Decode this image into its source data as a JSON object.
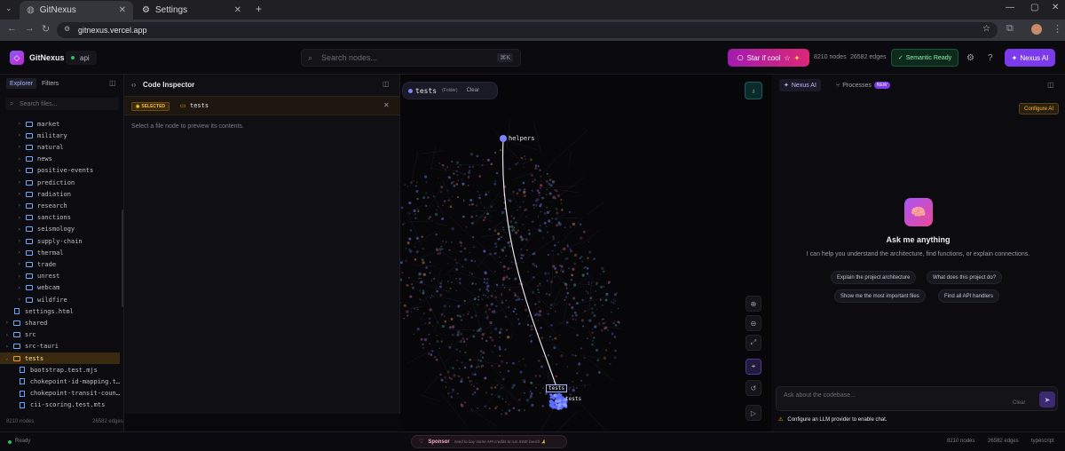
{
  "browser": {
    "tabs": [
      {
        "label": "GitNexus"
      },
      {
        "label": "Settings"
      }
    ],
    "url": "gitnexus.vercel.app"
  },
  "header": {
    "brand": "GitNexus",
    "repo": "api",
    "search_placeholder": "Search nodes...",
    "search_shortcut": "⌘K",
    "star_label": "Star if cool",
    "nodes_label": "8210 nodes",
    "edges_label": "26582 edges",
    "semantic_label": "Semantic Ready",
    "nexus_ai_label": "Nexus AI"
  },
  "sidebar": {
    "tabs": [
      "Explorer",
      "Filters"
    ],
    "search_placeholder": "Search files...",
    "tree": [
      {
        "label": "market",
        "type": "folder",
        "depth": 1
      },
      {
        "label": "military",
        "type": "folder",
        "depth": 1
      },
      {
        "label": "natural",
        "type": "folder",
        "depth": 1
      },
      {
        "label": "news",
        "type": "folder",
        "depth": 1
      },
      {
        "label": "positive-events",
        "type": "folder",
        "depth": 1
      },
      {
        "label": "prediction",
        "type": "folder",
        "depth": 1
      },
      {
        "label": "radiation",
        "type": "folder",
        "depth": 1
      },
      {
        "label": "research",
        "type": "folder",
        "depth": 1
      },
      {
        "label": "sanctions",
        "type": "folder",
        "depth": 1
      },
      {
        "label": "seismology",
        "type": "folder",
        "depth": 1
      },
      {
        "label": "supply-chain",
        "type": "folder",
        "depth": 1
      },
      {
        "label": "thermal",
        "type": "folder",
        "depth": 1
      },
      {
        "label": "trade",
        "type": "folder",
        "depth": 1
      },
      {
        "label": "unrest",
        "type": "folder",
        "depth": 1
      },
      {
        "label": "webcam",
        "type": "folder",
        "depth": 1
      },
      {
        "label": "wildfire",
        "type": "folder",
        "depth": 1
      },
      {
        "label": "settings.html",
        "type": "file",
        "depth": 0
      },
      {
        "label": "shared",
        "type": "folder",
        "depth": 0
      },
      {
        "label": "src",
        "type": "folder",
        "depth": 0
      },
      {
        "label": "src-tauri",
        "type": "folder",
        "depth": 0
      },
      {
        "label": "tests",
        "type": "folder-open",
        "depth": 0,
        "selected": true
      },
      {
        "label": "bootstrap.test.mjs",
        "type": "file",
        "depth": 1
      },
      {
        "label": "chokepoint-id-mapping.t…",
        "type": "file",
        "depth": 1
      },
      {
        "label": "chokepoint-transit-coun…",
        "type": "file",
        "depth": 1
      },
      {
        "label": "cii-scoring.test.mts",
        "type": "file",
        "depth": 1
      }
    ],
    "footer_nodes": "8210 nodes",
    "footer_edges": "26582 edges"
  },
  "inspector": {
    "title": "Code Inspector",
    "badge": "SELECTED",
    "selected_name": "tests",
    "hint": "Select a file node to preview its contents."
  },
  "graph": {
    "pill_name": "tests",
    "pill_type": "(Folder)",
    "pill_clear": "Clear",
    "label_helpers": "helpers",
    "label_tests_box": "tests",
    "label_tests": "tests"
  },
  "right": {
    "tabs": [
      "Nexus AI",
      "Processes"
    ],
    "new_badge": "NEW",
    "configure": "Configure AI",
    "ask_title": "Ask me anything",
    "ask_sub": "I can help you understand the architecture, find functions, or explain connections.",
    "suggestions": [
      "Explain the project architecture",
      "What does this project do?",
      "Show me the most important files",
      "Find all API handlers"
    ],
    "chat_placeholder": "Ask about the codebase...",
    "chat_clear": "Clear",
    "warning": "Configure an LLM provider to enable chat."
  },
  "status": {
    "ready": "Ready",
    "sponsor": "Sponsor",
    "sponsor_note": "need to buy some API credits to run SWE-bench 🙏",
    "nodes": "8210 nodes",
    "edges": "26582 edges",
    "lang": "typescript"
  },
  "colors": {
    "accent": "#7c3aed",
    "selected": "#f59e0b",
    "ok": "#22c55e"
  }
}
